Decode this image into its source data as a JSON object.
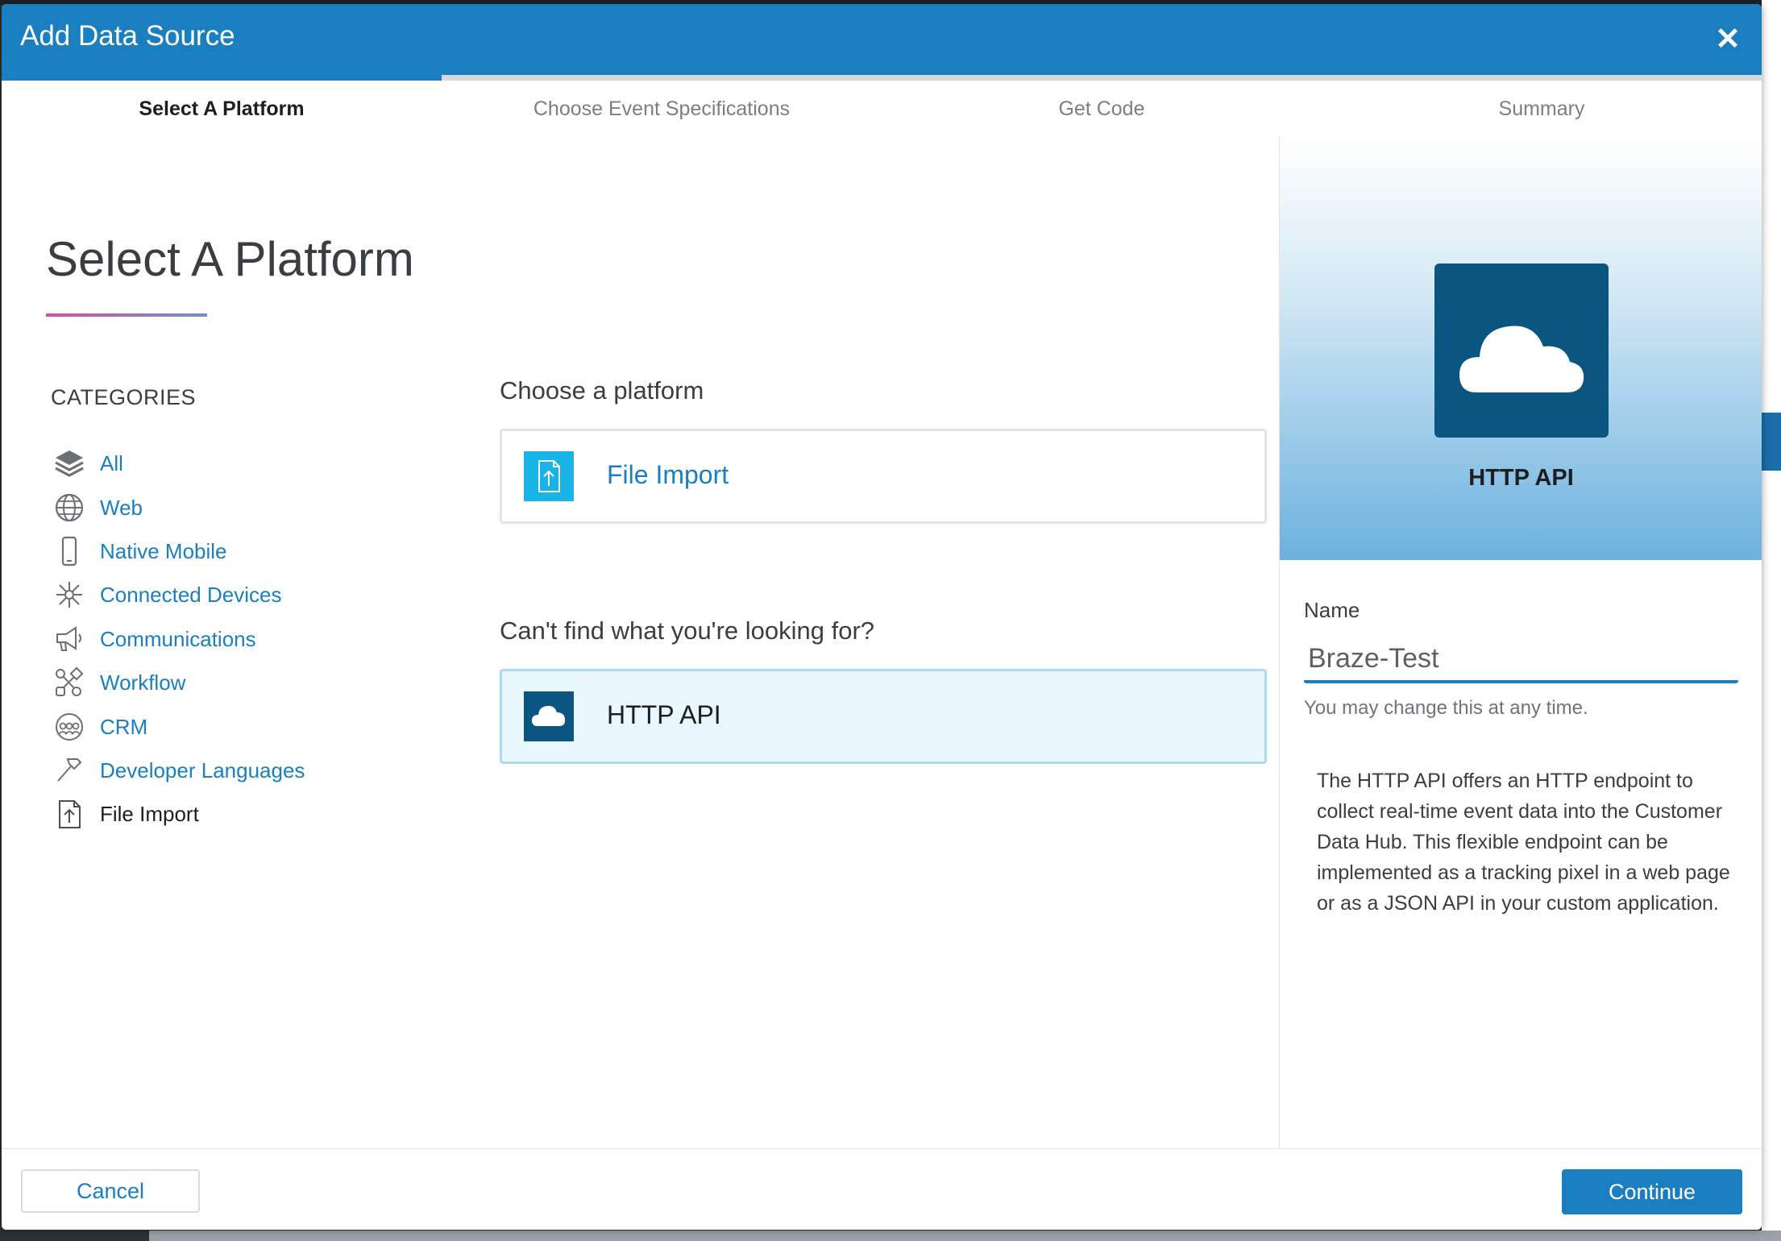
{
  "header": {
    "title": "Add Data Source",
    "close_icon": "close-icon",
    "accent": "#1a7fc1"
  },
  "steps": [
    {
      "label": "Select A Platform",
      "active": true
    },
    {
      "label": "Choose Event Specifications",
      "active": false
    },
    {
      "label": "Get Code",
      "active": false
    },
    {
      "label": "Summary",
      "active": false
    }
  ],
  "progress": {
    "current_step": 1,
    "total_steps": 4
  },
  "main": {
    "title": "Select A Platform",
    "categories_heading": "CATEGORIES",
    "categories": [
      {
        "label": "All",
        "icon": "layers-icon"
      },
      {
        "label": "Web",
        "icon": "globe-icon"
      },
      {
        "label": "Native Mobile",
        "icon": "mobile-phone-icon"
      },
      {
        "label": "Connected Devices",
        "icon": "network-hub-icon"
      },
      {
        "label": "Communications",
        "icon": "megaphone-icon"
      },
      {
        "label": "Workflow",
        "icon": "workflow-icon"
      },
      {
        "label": "CRM",
        "icon": "people-group-icon"
      },
      {
        "label": "Developer Languages",
        "icon": "hammer-icon"
      },
      {
        "label": "File Import",
        "icon": "file-upload-icon",
        "selected": true
      }
    ],
    "choose_label": "Choose a platform",
    "platforms": [
      {
        "label": "File Import",
        "icon": "file-upload-icon"
      }
    ],
    "cant_find_label": "Can't find what you're looking for?",
    "fallback_platform": {
      "label": "HTTP API",
      "icon": "cloud-icon",
      "selected": true
    }
  },
  "preview": {
    "label": "HTTP API",
    "icon": "cloud-icon",
    "name_label": "Name",
    "name_value": "Braze-Test",
    "name_hint": "You may change this at any time.",
    "description": "The HTTP API offers an HTTP endpoint to collect real-time event data into the Customer Data Hub. This flexible endpoint can be implemented as a tracking pixel in a web page or as a JSON API in your custom application."
  },
  "footer": {
    "cancel_label": "Cancel",
    "continue_label": "Continue"
  }
}
